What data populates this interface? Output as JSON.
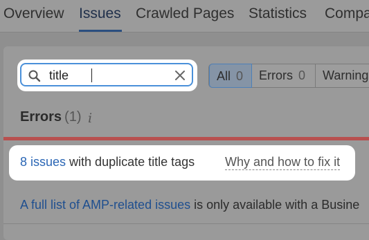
{
  "tabs": {
    "items": [
      {
        "label": "Overview"
      },
      {
        "label": "Issues"
      },
      {
        "label": "Crawled Pages"
      },
      {
        "label": "Statistics"
      },
      {
        "label": "Compa"
      }
    ],
    "active": "Issues"
  },
  "search": {
    "value": "title",
    "icon": "search-icon",
    "clear_icon": "close-icon"
  },
  "filters": {
    "all": {
      "label": "All",
      "count": "0"
    },
    "errors": {
      "label": "Errors",
      "count": "0"
    },
    "warnings": {
      "label": "Warning"
    }
  },
  "errors_section": {
    "title": "Errors",
    "count": "(1)",
    "info_icon": "i"
  },
  "issue": {
    "link_text": "8 issues",
    "description": " with duplicate title tags",
    "fix_link": "Why and how to fix it"
  },
  "amp_notice": {
    "link_text": "A full list of AMP-related issues",
    "text": " is only available with a Busine"
  },
  "colors": {
    "accent": "#4a90d9",
    "link": "#2a66b5",
    "error_bar": "#b8504f"
  }
}
